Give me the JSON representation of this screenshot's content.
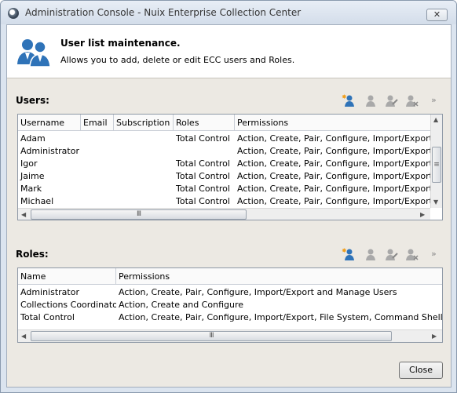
{
  "window": {
    "title": "Administration Console - Nuix Enterprise Collection Center",
    "close_glyph": "✕"
  },
  "header": {
    "title": "User list maintenance.",
    "subtitle": "Allows you to add, delete or edit ECC users and Roles.",
    "icon": "users-icon"
  },
  "users": {
    "label": "Users:",
    "toolbar": [
      "add-user-icon",
      "view-user-icon",
      "edit-user-icon",
      "delete-user-icon"
    ],
    "more": "»",
    "columns": [
      "Username",
      "Email",
      "Subscription",
      "Roles",
      "Permissions"
    ],
    "rows": [
      {
        "username": "Adam",
        "email": "",
        "subscription": "",
        "roles": "Total Control",
        "permissions": "Action, Create, Pair, Configure, Import/Export, File"
      },
      {
        "username": "Administrator",
        "email": "",
        "subscription": "",
        "roles": "",
        "permissions": "Action, Create, Pair, Configure, Import/Export, File"
      },
      {
        "username": "Igor",
        "email": "",
        "subscription": "",
        "roles": "Total Control",
        "permissions": "Action, Create, Pair, Configure, Import/Export, File"
      },
      {
        "username": "Jaime",
        "email": "",
        "subscription": "",
        "roles": "Total Control",
        "permissions": "Action, Create, Pair, Configure, Import/Export, File"
      },
      {
        "username": "Mark",
        "email": "",
        "subscription": "",
        "roles": "Total Control",
        "permissions": "Action, Create, Pair, Configure, Import/Export, File"
      },
      {
        "username": "Michael",
        "email": "",
        "subscription": "",
        "roles": "Total Control",
        "permissions": "Action, Create, Pair, Configure, Import/Export, File"
      }
    ]
  },
  "roles": {
    "label": "Roles:",
    "toolbar": [
      "add-role-icon",
      "view-role-icon",
      "edit-role-icon",
      "delete-role-icon"
    ],
    "more": "»",
    "columns": [
      "Name",
      "Permissions"
    ],
    "rows": [
      {
        "name": "Administrator",
        "permissions": "Action, Create, Pair, Configure, Import/Export and Manage Users"
      },
      {
        "name": "Collections Coordinator",
        "permissions": "Action, Create and Configure"
      },
      {
        "name": "Total Control",
        "permissions": "Action, Create, Pair, Configure, Import/Export, File System, Command Shell and Mana"
      }
    ]
  },
  "scroll": {
    "grip": "III",
    "up": "▲",
    "down": "▼",
    "left": "◀",
    "right": "▶",
    "vgrip": "≡"
  },
  "footer": {
    "close_label": "Close"
  }
}
